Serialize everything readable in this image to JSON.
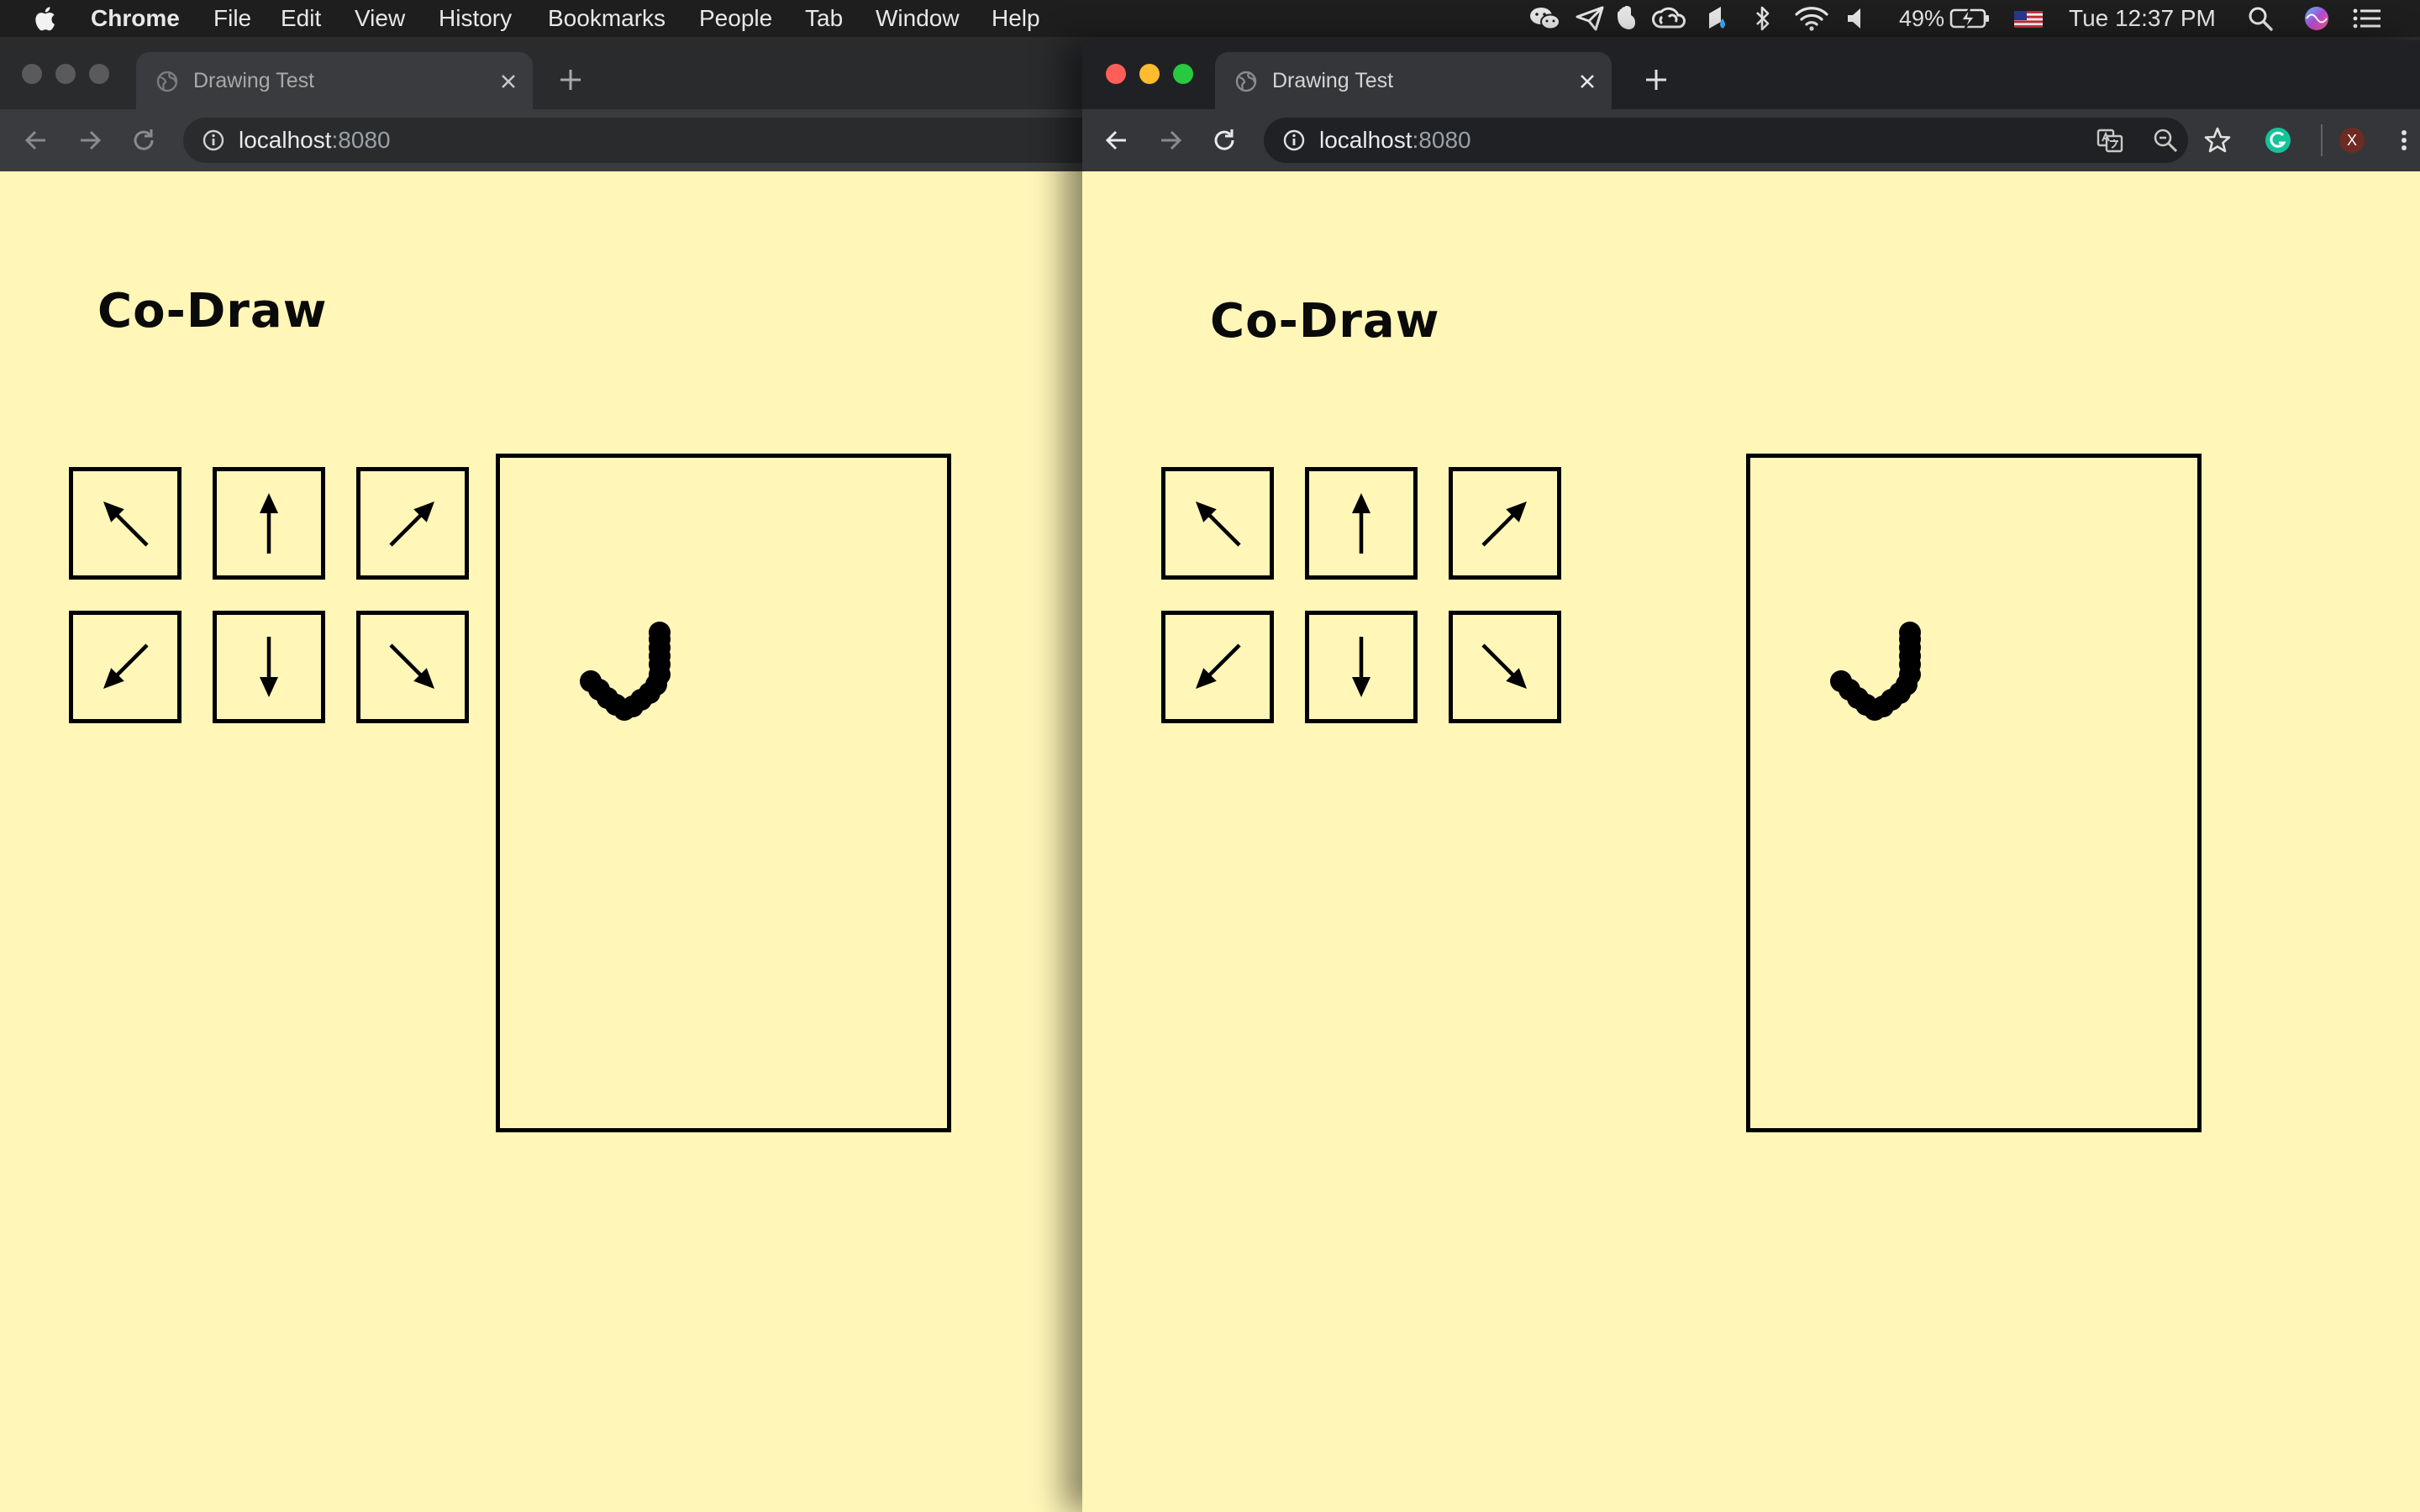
{
  "menubar": {
    "app_name": "Chrome",
    "items": [
      "File",
      "Edit",
      "View",
      "History",
      "Bookmarks",
      "People",
      "Tab",
      "Window",
      "Help"
    ],
    "battery_percent": "49%",
    "clock": "Tue 12:37 PM",
    "tray_icons": [
      "wechat-icon",
      "paper-plane-icon",
      "evernote-icon",
      "creative-cloud-icon",
      "droplet-icon",
      "bluetooth-icon",
      "wifi-icon",
      "volume-icon",
      "battery-icon",
      "us-flag-icon",
      "spotlight-search-icon",
      "siri-icon",
      "notification-center-icon"
    ]
  },
  "windows": [
    {
      "id": "left",
      "focused": false,
      "tab_title": "Drawing Test",
      "url_host": "localhost",
      "url_port": ":8080",
      "page_title": "Co-Draw"
    },
    {
      "id": "right",
      "focused": true,
      "tab_title": "Drawing Test",
      "url_host": "localhost",
      "url_port": ":8080",
      "page_title": "Co-Draw",
      "profile_initial": "X"
    }
  ],
  "arrow_buttons": [
    "up-left",
    "up",
    "up-right",
    "down-left",
    "down",
    "down-right"
  ],
  "colors": {
    "page_background": "#fff6b8",
    "ink": "#000000",
    "traffic_close": "#ff5f57",
    "traffic_minimize": "#febc2e",
    "traffic_zoom": "#28c840",
    "grammarly": "#15c39a",
    "profile": "#6d2b23"
  }
}
